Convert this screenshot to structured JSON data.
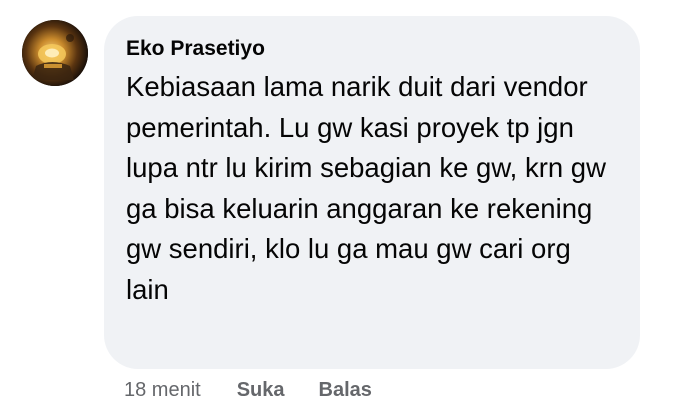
{
  "comment": {
    "author": "Eko Prasetiyo",
    "text": "Kebiasaan lama narik duit dari vendor pemerintah. Lu gw kasi proyek tp jgn lupa ntr lu kirim sebagian ke gw, krn gw ga bisa keluarin anggaran ke rekening gw sendiri, klo lu ga mau gw cari org lain",
    "avatar_icon": "profile-avatar",
    "bubble_color": "#f0f2f5"
  },
  "actions": {
    "time": "18 menit",
    "like_label": "Suka",
    "reply_label": "Balas",
    "text_color": "#65676b"
  }
}
